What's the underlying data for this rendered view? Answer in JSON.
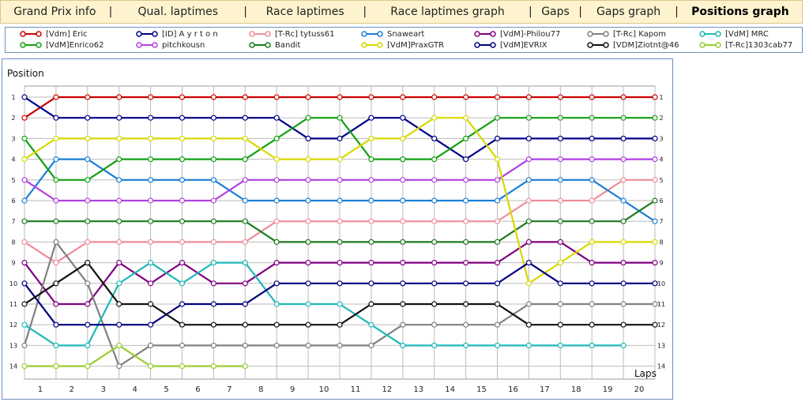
{
  "tabs": [
    {
      "label": "Grand Prix info",
      "active": false
    },
    {
      "label": "Qual. laptimes",
      "active": false
    },
    {
      "label": "Race laptimes",
      "active": false
    },
    {
      "label": "Race laptimes graph",
      "active": false
    },
    {
      "label": "Gaps",
      "active": false
    },
    {
      "label": "Gaps graph",
      "active": false
    },
    {
      "label": "Positions graph",
      "active": true
    }
  ],
  "separator": "|",
  "chart_data": {
    "type": "line",
    "ylabel": "Position",
    "xlabel": "Laps",
    "xlim": [
      0,
      20
    ],
    "ylim": [
      1,
      14
    ],
    "y_inverted": true,
    "grid": true,
    "legend_placement": "top",
    "x_ticks": [
      "1",
      "2",
      "3",
      "4",
      "5",
      "6",
      "7",
      "8",
      "9",
      "10",
      "11",
      "12",
      "13",
      "14",
      "15",
      "16",
      "17",
      "18",
      "19",
      "20"
    ],
    "y_ticks": [
      "1",
      "2",
      "3",
      "4",
      "5",
      "6",
      "7",
      "8",
      "9",
      "10",
      "11",
      "12",
      "13",
      "14"
    ],
    "series": [
      {
        "name": "[Vdm] Eric",
        "color": "#cc0000",
        "values": [
          2,
          1,
          1,
          1,
          1,
          1,
          1,
          1,
          1,
          1,
          1,
          1,
          1,
          1,
          1,
          1,
          1,
          1,
          1,
          1,
          1
        ]
      },
      {
        "name": "[ID] A y r t o n",
        "color": "#00008b",
        "values": [
          1,
          2,
          2,
          2,
          2,
          2,
          2,
          2,
          2,
          3,
          3,
          2,
          2,
          3,
          4,
          3,
          3,
          3,
          3,
          3,
          3
        ]
      },
      {
        "name": "[T-Rc] tytuss61",
        "color": "#f08c9c",
        "values": [
          8,
          9,
          8,
          8,
          8,
          8,
          8,
          8,
          7,
          7,
          7,
          7,
          7,
          7,
          7,
          7,
          6,
          6,
          6,
          5,
          5
        ]
      },
      {
        "name": "Snaweart",
        "color": "#1a7ed6",
        "values": [
          6,
          4,
          4,
          5,
          5,
          5,
          5,
          6,
          6,
          6,
          6,
          6,
          6,
          6,
          6,
          6,
          5,
          5,
          5,
          6,
          7
        ]
      },
      {
        "name": "[VdM]-Philou77",
        "color": "#800080",
        "values": [
          9,
          11,
          11,
          9,
          10,
          9,
          10,
          10,
          9,
          9,
          9,
          9,
          9,
          9,
          9,
          9,
          8,
          8,
          9,
          9,
          9
        ]
      },
      {
        "name": "[T-Rc] Kapom",
        "color": "#808080",
        "values": [
          13,
          8,
          10,
          14,
          13,
          13,
          13,
          13,
          13,
          13,
          13,
          13,
          12,
          12,
          12,
          12,
          11,
          11,
          11,
          11,
          11
        ]
      },
      {
        "name": "[VdM] MRC",
        "color": "#20b8b8",
        "values": [
          12,
          13,
          13,
          10,
          9,
          10,
          9,
          9,
          11,
          11,
          11,
          12,
          13,
          13,
          13,
          13,
          13,
          13,
          13,
          13
        ]
      },
      {
        "name": "[VdM]Enrico62",
        "color": "#13a013",
        "values": [
          3,
          5,
          5,
          4,
          4,
          4,
          4,
          4,
          3,
          2,
          2,
          4,
          4,
          4,
          3,
          2,
          2,
          2,
          2,
          2,
          2
        ]
      },
      {
        "name": "pitchkousn",
        "color": "#b040e0",
        "values": [
          5,
          6,
          6,
          6,
          6,
          6,
          6,
          5,
          5,
          5,
          5,
          5,
          5,
          5,
          5,
          5,
          4,
          4,
          4,
          4,
          4
        ]
      },
      {
        "name": "Bandit",
        "color": "#1e7a1e",
        "values": [
          7,
          7,
          7,
          7,
          7,
          7,
          7,
          7,
          8,
          8,
          8,
          8,
          8,
          8,
          8,
          8,
          7,
          7,
          7,
          7,
          6
        ]
      },
      {
        "name": "[VdM]PraxGTR",
        "color": "#d8d800",
        "values": [
          4,
          3,
          3,
          3,
          3,
          3,
          3,
          3,
          4,
          4,
          4,
          3,
          3,
          2,
          2,
          4,
          10,
          9,
          8,
          8,
          8
        ]
      },
      {
        "name": "[VdM]EVRIX",
        "color": "#000080",
        "values": [
          10,
          12,
          12,
          12,
          12,
          11,
          11,
          11,
          10,
          10,
          10,
          10,
          10,
          10,
          10,
          10,
          9,
          10,
          10,
          10,
          10
        ]
      },
      {
        "name": "[VDM]Ziotnt@46",
        "color": "#111111",
        "values": [
          11,
          10,
          9,
          11,
          11,
          12,
          12,
          12,
          12,
          12,
          12,
          11,
          11,
          11,
          11,
          11,
          12,
          12,
          12,
          12,
          12
        ]
      },
      {
        "name": "[T-Rc]1303cab77",
        "color": "#9acd32",
        "values": [
          14,
          14,
          14,
          13,
          14,
          14,
          14,
          14
        ]
      }
    ]
  }
}
